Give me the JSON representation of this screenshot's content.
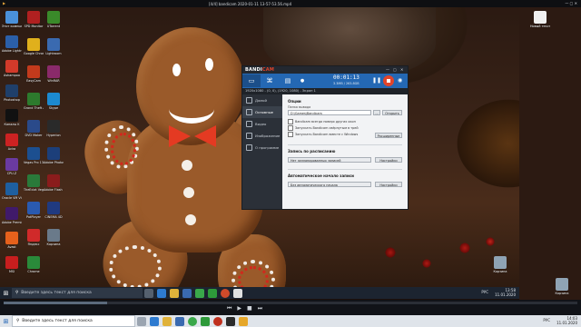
{
  "player": {
    "title": "[4/4] bandicam 2020-01-11 13-57-53.56.mp4"
  },
  "desktop_icons_left": [
    {
      "label": "Этот компьютер",
      "color": "#4a90d9"
    },
    {
      "label": "Adobe Lightroom",
      "color": "#2b5fa8"
    },
    {
      "label": "Ashampoo",
      "color": "#d23a2a"
    },
    {
      "label": "Photoshop",
      "color": "#1f3f6a"
    },
    {
      "label": "Каналы K",
      "color": "#111111"
    },
    {
      "label": "Avira",
      "color": "#cc2222"
    },
    {
      "label": "CPU-Z",
      "color": "#6a3aa0"
    },
    {
      "label": "Oracle VM VirtualBox",
      "color": "#1e5fa0"
    },
    {
      "label": "Adobe Premiere",
      "color": "#401a6a"
    },
    {
      "label": "Avast",
      "color": "#e6611c"
    },
    {
      "label": "MSI",
      "color": "#c81e1e"
    }
  ],
  "desktop_icons_col2": [
    {
      "label": "SPD Monitor",
      "color": "#b02020"
    },
    {
      "label": "Google Chrome",
      "color": "#e0b01c"
    },
    {
      "label": "EasyCam",
      "color": "#c23a1c"
    },
    {
      "label": "Grand Theft Auto V",
      "color": "#2d7a2d"
    },
    {
      "label": "DVD Maker",
      "color": "#2a4a8a"
    },
    {
      "label": "Vegas Pro 13.0",
      "color": "#1c4f90"
    },
    {
      "label": "TheEclat Vegas Pro",
      "color": "#2a7a3a"
    },
    {
      "label": "PotPlayer",
      "color": "#2a5ab0"
    },
    {
      "label": "Яндекс",
      "color": "#d02a2a"
    },
    {
      "label": "Chrome",
      "color": "#2a8a3a"
    }
  ],
  "desktop_icons_col3": [
    {
      "label": "UTorrent",
      "color": "#3a8a2a"
    },
    {
      "label": "Lightroom",
      "color": "#3a6ab0"
    },
    {
      "label": "WinRAR",
      "color": "#8a2a6a"
    },
    {
      "label": "Skype",
      "color": "#1c8ad0"
    },
    {
      "label": "Hyperion",
      "color": "#2a2a2a"
    },
    {
      "label": "Adobe Photoshop",
      "color": "#1c3f7a"
    },
    {
      "label": "Adobe Flash Player",
      "color": "#8a1c1c"
    },
    {
      "label": "CINEMA 4D",
      "color": "#203a80"
    },
    {
      "label": "Корзина",
      "color": "#6a7a8a"
    }
  ],
  "desktop_icons_right": [
    {
      "label": "Новый текстовый...",
      "color": "#e8e8e8"
    }
  ],
  "recycle_bin": {
    "label": "Корзина"
  },
  "bandicam": {
    "logo_a": "BANDI",
    "logo_b": "CAM",
    "timer": "00:01:13",
    "size": "3.3MB / 263.8GB",
    "info": "1920x1080 - (0, 0), (1920, 1080) - Экран 1",
    "nav": [
      {
        "label": "Домой"
      },
      {
        "label": "Основные"
      },
      {
        "label": "Видео"
      },
      {
        "label": "Изображение"
      },
      {
        "label": "О программе"
      }
    ],
    "section_options": "Опции",
    "output_folder_label": "Папка вывода",
    "output_folder_value": "D:\\Games\\Bandicam",
    "browse_btn": "...",
    "open_btn": "Открыть",
    "checkboxes": [
      "Bandicam всегда поверх других окон",
      "Запускать Bandicam свёрнутым в трей",
      "Запускать Bandicam вместе с Windows"
    ],
    "advanced_btn": "Расширенные",
    "section_schedule": "Запись по расписанию",
    "schedule_text": "Нет запланированных записей",
    "settings_btn": "Настройки",
    "section_autostart": "Автоматическое начало записи",
    "autostart_text": "Без автоматического начала",
    "settings_btn2": "Настройки"
  },
  "taskbar_inner": {
    "search": "Введите здесь текст для поиска",
    "lang": "РУС",
    "time": "13:58",
    "date": "11.01.2020"
  },
  "taskbar_outer": {
    "search": "Введите здесь текст для поиска",
    "lang": "РУС",
    "time": "14:03",
    "date": "11.01.2020"
  }
}
